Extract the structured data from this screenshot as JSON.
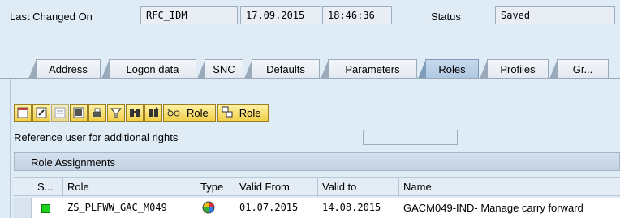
{
  "header": {
    "last_changed_label": "Last Changed On",
    "user": "RFC_IDM",
    "date": "17.09.2015",
    "time": "18:46:36",
    "status_label": "Status",
    "status_value": "Saved"
  },
  "tabs": [
    {
      "label": "Address"
    },
    {
      "label": "Logon data"
    },
    {
      "label": "SNC"
    },
    {
      "label": "Defaults"
    },
    {
      "label": "Parameters"
    },
    {
      "label": "Roles",
      "active": true
    },
    {
      "label": "Profiles"
    },
    {
      "label": "Gr..."
    }
  ],
  "toolbar": {
    "role_btn1_label": "Role",
    "role_btn2_label": "Role"
  },
  "reference_user_label": "Reference user for additional rights",
  "table": {
    "caption": "Role Assignments",
    "columns": [
      "S...",
      "Role",
      "Type",
      "Valid From",
      "Valid to",
      "Name"
    ],
    "rows": [
      {
        "role": "ZS_PLFWW_GAC_M049",
        "valid_from": "01.07.2015",
        "valid_to": "14.08.2015",
        "name": "GACM049-IND- Manage carry forward"
      }
    ]
  },
  "colors": {
    "background": "#dfebf5",
    "button": "#f1cf4a",
    "status_green": "#1cd11c"
  }
}
